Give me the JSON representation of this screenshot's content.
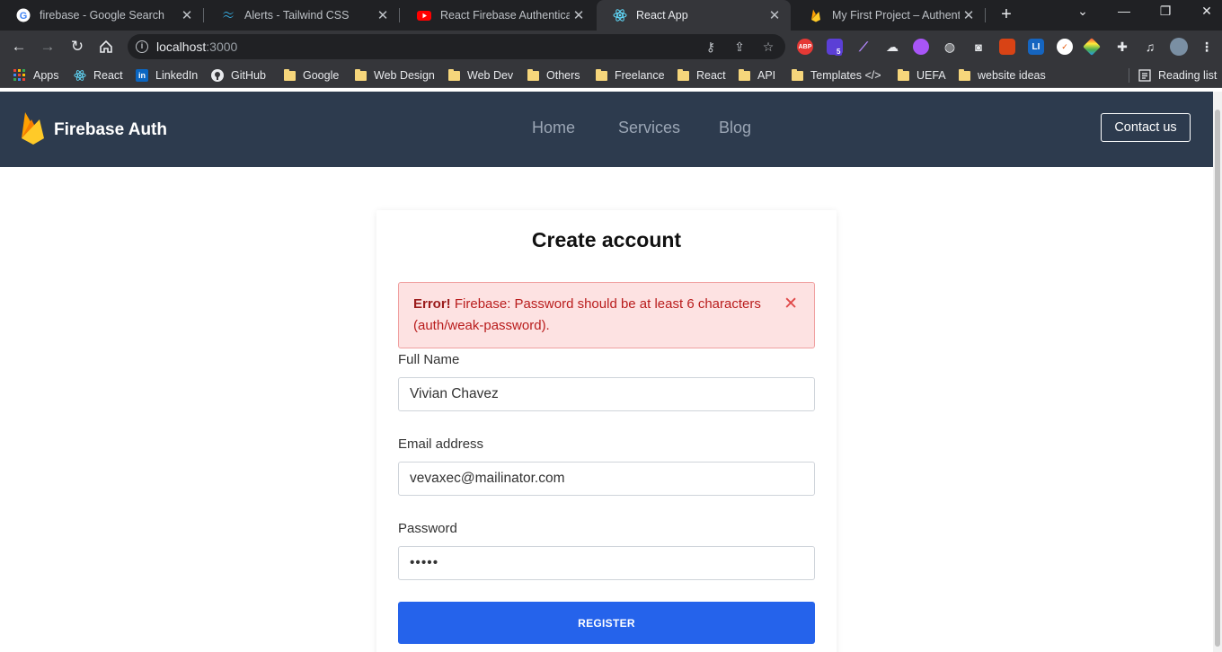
{
  "browser": {
    "tabs": [
      {
        "title": "firebase - Google Search",
        "icon": "google-icon",
        "active": false
      },
      {
        "title": "Alerts - Tailwind CSS",
        "icon": "tailwind-icon",
        "active": false
      },
      {
        "title": "React Firebase Authentication",
        "icon": "youtube-icon",
        "active": false
      },
      {
        "title": "React App",
        "icon": "react-icon",
        "active": true
      },
      {
        "title": "My First Project – Authentication",
        "icon": "firebase-icon",
        "active": false
      }
    ],
    "address": {
      "host": "localhost",
      "port": ":3000"
    },
    "bookmarks": [
      {
        "label": "Apps",
        "icon": "apps-grid-icon"
      },
      {
        "label": "React",
        "icon": "react-icon"
      },
      {
        "label": "LinkedIn",
        "icon": "linkedin-icon"
      },
      {
        "label": "GitHub",
        "icon": "github-icon"
      },
      {
        "label": "Google",
        "icon": "folder-icon"
      },
      {
        "label": "Web Design",
        "icon": "folder-icon"
      },
      {
        "label": "Web Dev",
        "icon": "folder-icon"
      },
      {
        "label": "Others",
        "icon": "folder-icon"
      },
      {
        "label": "Freelance",
        "icon": "folder-icon"
      },
      {
        "label": "React",
        "icon": "folder-icon"
      },
      {
        "label": "API",
        "icon": "folder-icon"
      },
      {
        "label": "Templates </>",
        "icon": "folder-icon"
      },
      {
        "label": "UEFA",
        "icon": "folder-icon"
      },
      {
        "label": "website ideas",
        "icon": "folder-icon"
      }
    ],
    "reading_list": "Reading list",
    "extension_badge": "5",
    "abp_label": "ABP",
    "li_label": "LI"
  },
  "navbar": {
    "brand": "Firebase Auth",
    "links": [
      "Home",
      "Services",
      "Blog"
    ],
    "contact": "Contact us"
  },
  "form": {
    "title": "Create account",
    "alert": {
      "strong": "Error!",
      "message": "Firebase: Password should be at least 6 characters (auth/weak-password)."
    },
    "full_name_label": "Full Name",
    "full_name_value": "Vivian Chavez",
    "email_label": "Email address",
    "email_value": "vevaxec@mailinator.com",
    "password_label": "Password",
    "password_value": "•••••",
    "submit": "REGISTER"
  },
  "colors": {
    "navbar_bg": "#2d3b4e",
    "primary_button": "#2563eb",
    "alert_bg": "#fde2e2",
    "alert_text": "#b91c1c"
  }
}
